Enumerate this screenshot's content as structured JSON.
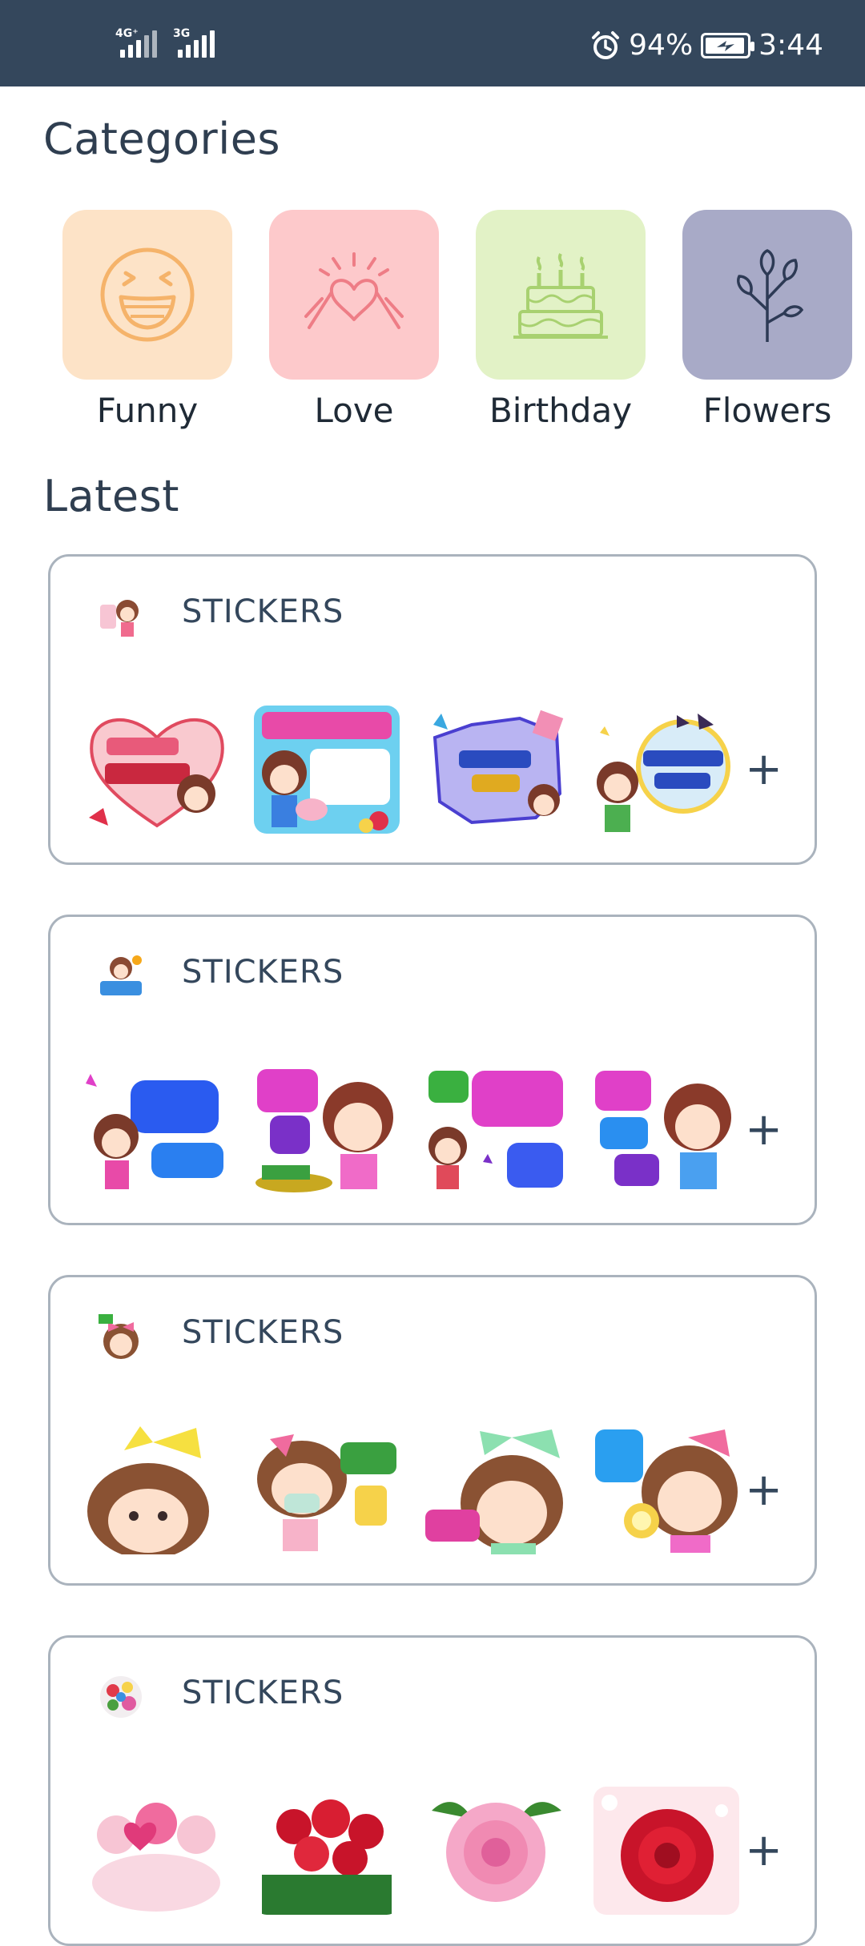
{
  "status_bar": {
    "network1": "4G⁺",
    "network2": "3G",
    "battery_percent": "94%",
    "time": "3:44",
    "icons": [
      "alarm-icon",
      "battery-charging-icon",
      "signal-icon"
    ]
  },
  "categories": {
    "title": "Categories",
    "items": [
      {
        "label": "Funny",
        "icon": "laughing-face-icon",
        "bg": "#fde3c7",
        "stroke": "#f5b36a"
      },
      {
        "label": "Love",
        "icon": "heart-hands-icon",
        "bg": "#fdc9cb",
        "stroke": "#ee7d86"
      },
      {
        "label": "Birthday",
        "icon": "birthday-cake-icon",
        "bg": "#e2f2c6",
        "stroke": "#a8d170"
      },
      {
        "label": "Flowers",
        "icon": "flower-icon",
        "bg": "#a8aac7",
        "stroke": "#2d3a55"
      }
    ]
  },
  "latest": {
    "title": "Latest",
    "packs": [
      {
        "title": "STICKERS",
        "add_label": "+"
      },
      {
        "title": "STICKERS",
        "add_label": "+"
      },
      {
        "title": "STICKERS",
        "add_label": "+"
      },
      {
        "title": "STICKERS",
        "add_label": "+"
      }
    ]
  },
  "colors": {
    "status_bar": "#34475c",
    "heading": "#2f3e50",
    "card_border": "#aab3bd"
  }
}
